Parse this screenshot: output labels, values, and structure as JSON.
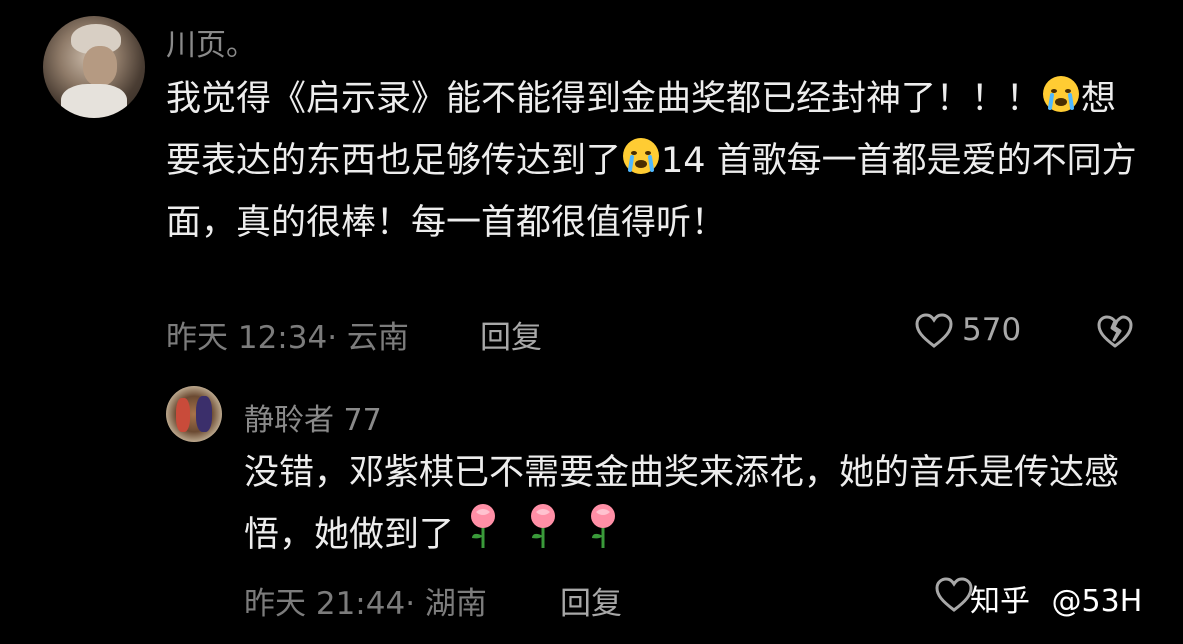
{
  "comment": {
    "username": "川页。",
    "text": "我觉得《启示录》能不能得到金曲奖都已经封神了！！！",
    "text_2": "想要表达的东西也足够传达到了",
    "text_3": "14 首歌每一首都是爱的不同方面，真的很棒！每一首都很值得听！",
    "time": "昨天 12:34",
    "location": "云南",
    "reply_label": "回复",
    "like_count": "570",
    "emoji_icon": "crying-face-icon"
  },
  "reply": {
    "username": "静聆者 77",
    "text": "没错，邓紫棋已不需要金曲奖来添花，她的音乐是传达感悟，她做到了",
    "time": "昨天 21:44",
    "location": "湖南",
    "reply_label": "回复",
    "emoji_icon": "rose-icon"
  },
  "watermark": {
    "site": "知乎",
    "user": "@53H"
  },
  "colors": {
    "background": "#000000",
    "text": "#ededed",
    "muted": "#7c7c7c"
  }
}
